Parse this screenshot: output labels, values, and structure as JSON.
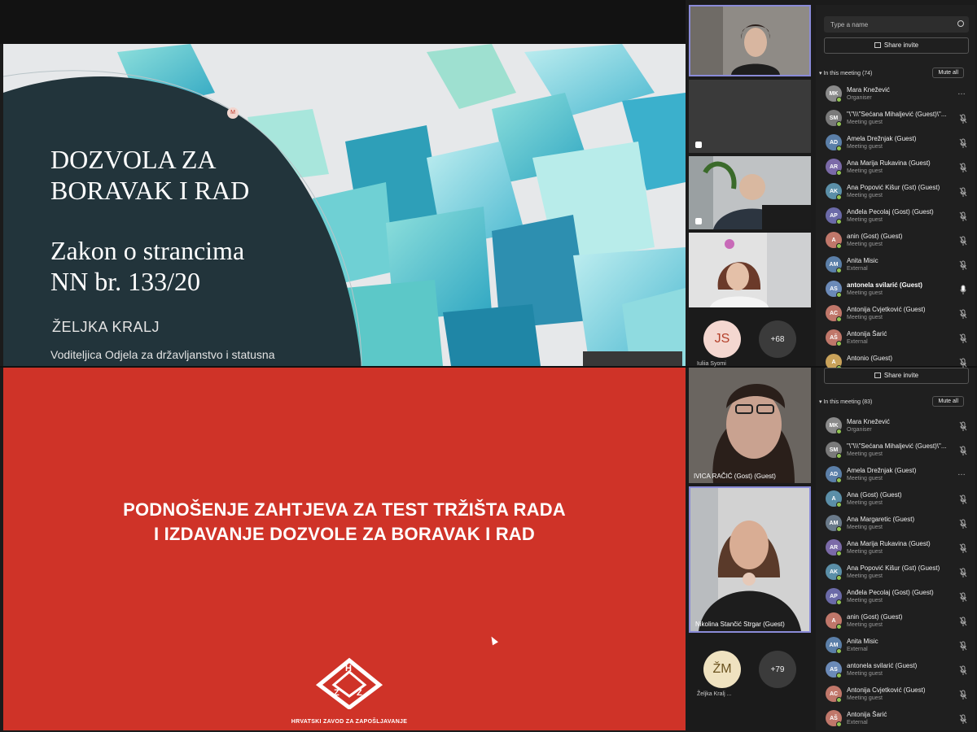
{
  "top_slide": {
    "title_line1": "DOZVOLA ZA",
    "title_line2": "BORAVAK I RAD",
    "subtitle_line1": "Zakon o strancima",
    "subtitle_line2": "NN br. 133/20",
    "author": "ŽELJKA KRALJ",
    "author_role": "Voditeljica Odjela za državljanstvo i statusna",
    "marker": "M"
  },
  "bottom_slide": {
    "title_line1": "PODNOŠENJE ZAHTJEVA ZA TEST TRŽIŠTA RADA",
    "title_line2": "I IZDAVANJE DOZVOLE ZA BORAVAK I RAD",
    "logo_caption": "HRVATSKI ZAVOD ZA ZAPOŠLJAVANJE",
    "logo_letters": [
      "H",
      "Z",
      "Z"
    ]
  },
  "videos_top": {
    "avatar_initials": "JS",
    "avatar_name": "Iuliia Syomi",
    "more_count": "+68"
  },
  "videos_bottom": {
    "tile1_label": "IVICA RAČIĆ (Gost) (Guest)",
    "tile2_label": "Nikolina Stančić Strgar (Guest)",
    "avatar_initials": "ŽM",
    "avatar_name": "Željka Kralj ...",
    "more_count": "+79"
  },
  "panel_top": {
    "search_placeholder": "Type a name",
    "share_label": "Share invite",
    "section_label": "In this meeting (74)",
    "mute_all": "Mute all",
    "participants": [
      {
        "initials": "MK",
        "name": "Mara Knežević",
        "role": "Organiser",
        "color": "#8a8a8a",
        "mic": "none",
        "more": "…"
      },
      {
        "initials": "SM",
        "name": "\"\\\"\\\\\\\"Sećana Mihaljević (Guest)\\\"...",
        "role": "Meeting guest",
        "color": "#7a7a7a",
        "mic": "muted"
      },
      {
        "initials": "AD",
        "name": "Amela Drežnjak (Guest)",
        "role": "Meeting guest",
        "color": "#5b7fa8",
        "mic": "muted"
      },
      {
        "initials": "AR",
        "name": "Ana Marija Rukavina (Guest)",
        "role": "Meeting guest",
        "color": "#7b6aa8",
        "mic": "muted"
      },
      {
        "initials": "AK",
        "name": "Ana Popović Kišur (Gst) (Guest)",
        "role": "Meeting guest",
        "color": "#5b8fa8",
        "mic": "muted"
      },
      {
        "initials": "AP",
        "name": "Anđela Pecolaj (Gost) (Guest)",
        "role": "Meeting guest",
        "color": "#6b6aa8",
        "mic": "muted"
      },
      {
        "initials": "A",
        "name": "anin (Gost) (Guest)",
        "role": "Meeting guest",
        "color": "#c0776a",
        "mic": "muted"
      },
      {
        "initials": "AM",
        "name": "Anita Misic",
        "role": "External",
        "color": "#5b7fa8",
        "mic": "muted"
      },
      {
        "initials": "AS",
        "name": "antonela svilarić (Guest)",
        "role": "Meeting guest",
        "color": "#6b8ab8",
        "mic": "on",
        "bold": true
      },
      {
        "initials": "AC",
        "name": "Antonija Cvjetković (Guest)",
        "role": "Meeting guest",
        "color": "#c0776a",
        "mic": "muted"
      },
      {
        "initials": "AŠ",
        "name": "Antonija Šarić",
        "role": "External",
        "color": "#c0776a",
        "mic": "muted"
      },
      {
        "initials": "A",
        "name": "Antonio (Guest)",
        "role": "",
        "color": "#c9a25a",
        "mic": "muted"
      }
    ]
  },
  "panel_bottom": {
    "share_label": "Share invite",
    "section_label": "In this meeting (83)",
    "mute_all": "Mute all",
    "participants": [
      {
        "initials": "MK",
        "name": "Mara Knežević",
        "role": "Organiser",
        "color": "#8a8a8a",
        "mic": "muted"
      },
      {
        "initials": "SM",
        "name": "\"\\\"\\\\\\\"Sećana Mihaljević (Guest)\\\"...",
        "role": "Meeting guest",
        "color": "#7a7a7a",
        "mic": "muted"
      },
      {
        "initials": "AD",
        "name": "Amela Drežnjak (Guest)",
        "role": "Meeting guest",
        "color": "#5b7fa8",
        "mic": "none",
        "more": "…"
      },
      {
        "initials": "A",
        "name": "Ana (Gost) (Guest)",
        "role": "Meeting guest",
        "color": "#5b8fa8",
        "mic": "muted"
      },
      {
        "initials": "AM",
        "name": "Ana Margaretic (Guest)",
        "role": "Meeting guest",
        "color": "#6a7a8a",
        "mic": "muted"
      },
      {
        "initials": "AR",
        "name": "Ana Marija Rukavina (Guest)",
        "role": "Meeting guest",
        "color": "#7b6aa8",
        "mic": "muted"
      },
      {
        "initials": "AK",
        "name": "Ana Popović Kišur (Gst) (Guest)",
        "role": "Meeting guest",
        "color": "#5b8fa8",
        "mic": "muted"
      },
      {
        "initials": "AP",
        "name": "Anđela Pecolaj (Gost) (Guest)",
        "role": "Meeting guest",
        "color": "#6b6aa8",
        "mic": "muted"
      },
      {
        "initials": "A",
        "name": "anin (Gost) (Guest)",
        "role": "Meeting guest",
        "color": "#c0776a",
        "mic": "muted"
      },
      {
        "initials": "AM",
        "name": "Anita Misic",
        "role": "External",
        "color": "#5b7fa8",
        "mic": "muted"
      },
      {
        "initials": "AS",
        "name": "antonela svilarić (Guest)",
        "role": "Meeting guest",
        "color": "#6b8ab8",
        "mic": "muted"
      },
      {
        "initials": "AC",
        "name": "Antonija Cvjetković (Guest)",
        "role": "Meeting guest",
        "color": "#c0776a",
        "mic": "muted"
      },
      {
        "initials": "AŠ",
        "name": "Antonija Šarić",
        "role": "External",
        "color": "#c0776a",
        "mic": "muted"
      }
    ]
  }
}
